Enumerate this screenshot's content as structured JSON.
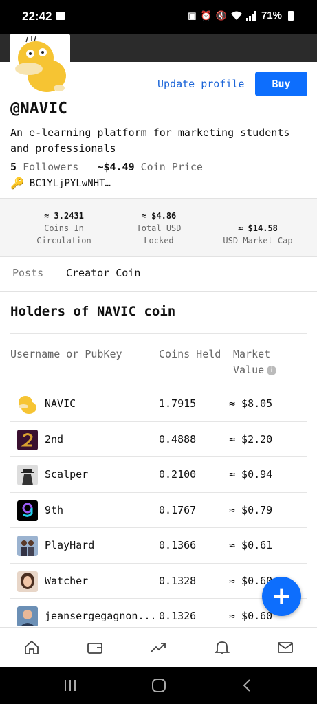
{
  "status_bar": {
    "time": "22:42",
    "battery": "71%"
  },
  "profile": {
    "username": "@NAVIC",
    "description": "An e-learning platform for marketing students and professionals",
    "followers_count": "5",
    "followers_label": "Followers",
    "coin_price_value": "~$4.49",
    "coin_price_label": "Coin Price",
    "public_key": "BC1YLjPYLwNHT…",
    "update_profile_label": "Update profile",
    "buy_label": "Buy"
  },
  "metrics": [
    {
      "value": "≈ 3.2431",
      "label_line1": "Coins In",
      "label_line2": "Circulation"
    },
    {
      "value": "≈ $4.86",
      "label_line1": "Total USD",
      "label_line2": "Locked"
    },
    {
      "value": "≈ $14.58",
      "label_line1": "USD Market Cap",
      "label_line2": ""
    }
  ],
  "tabs": [
    {
      "label": "Posts",
      "active": false
    },
    {
      "label": "Creator Coin",
      "active": true
    }
  ],
  "holders": {
    "title": "Holders of NAVIC coin",
    "columns": {
      "username": "Username or PubKey",
      "coins": "Coins Held",
      "value_line1": "Market",
      "value_line2": "Value"
    },
    "rows": [
      {
        "name": "NAVIC",
        "coins": "1.7915",
        "value": "≈ $8.05"
      },
      {
        "name": "2nd",
        "coins": "0.4888",
        "value": "≈ $2.20"
      },
      {
        "name": "Scalper",
        "coins": "0.2100",
        "value": "≈ $0.94"
      },
      {
        "name": "9th",
        "coins": "0.1767",
        "value": "≈ $0.79"
      },
      {
        "name": "PlayHard",
        "coins": "0.1366",
        "value": "≈ $0.61"
      },
      {
        "name": "Watcher",
        "coins": "0.1328",
        "value": "≈ $0.60"
      },
      {
        "name": "jeansergegagnon...",
        "coins": "0.1326",
        "value": "≈ $0.60"
      }
    ]
  },
  "fab": {
    "label": "+"
  },
  "bottom_nav": [
    "home-icon",
    "wallet-icon",
    "trending-icon",
    "bell-icon",
    "mail-icon"
  ],
  "colors": {
    "accent": "#0d6efd",
    "link": "#1d66d8"
  }
}
